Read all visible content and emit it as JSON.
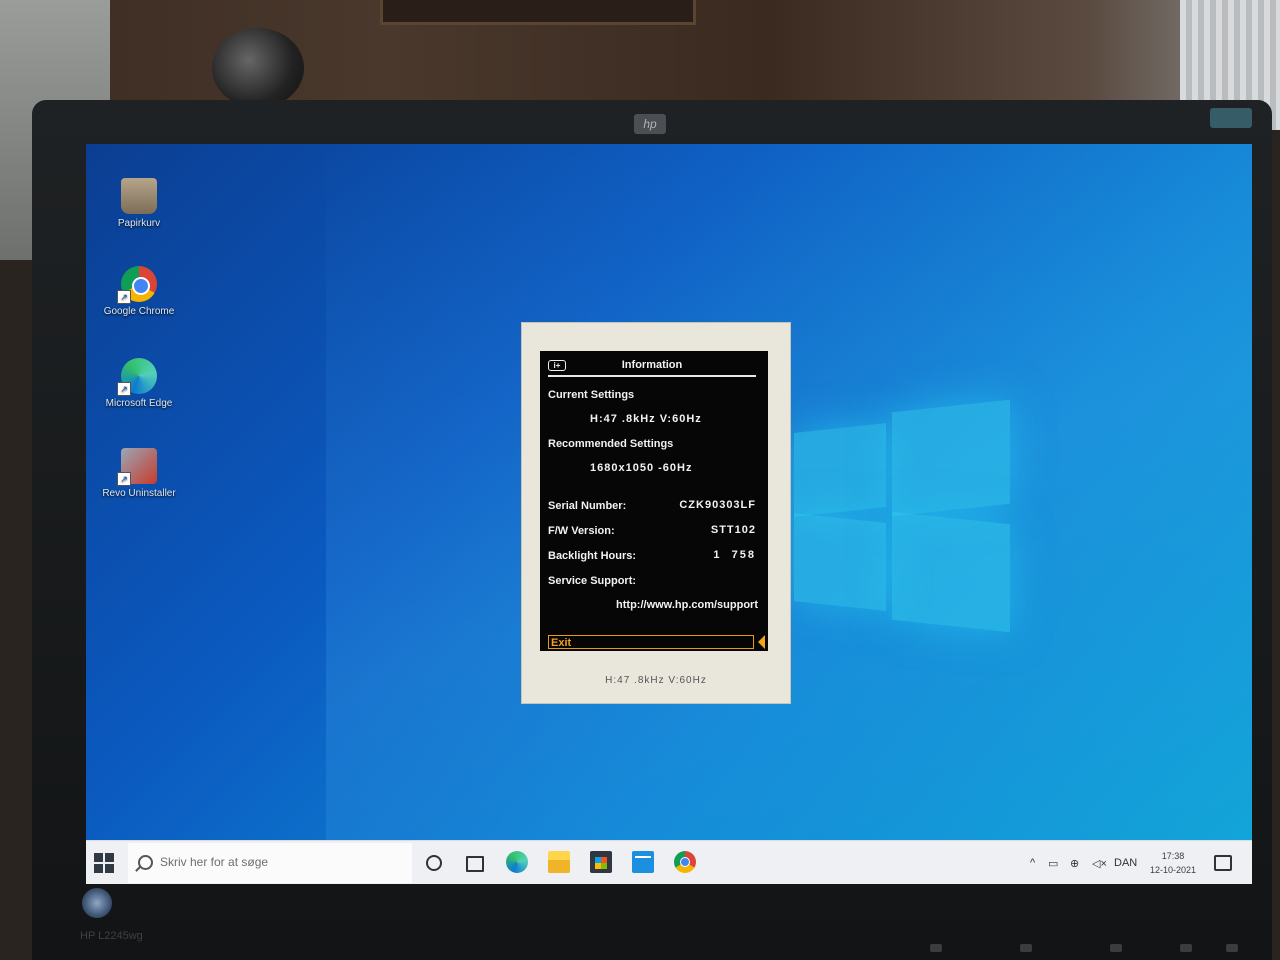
{
  "desktop": {
    "icons": [
      {
        "label": "Papirkurv",
        "icon": "recycle-bin-icon"
      },
      {
        "label": "Google Chrome",
        "icon": "chrome-icon"
      },
      {
        "label": "Microsoft Edge",
        "icon": "edge-icon"
      },
      {
        "label": "Revo Uninstaller",
        "icon": "revo-uninstaller-icon"
      }
    ]
  },
  "monitor": {
    "brand_logo": "hp",
    "model": "HP L2245wg"
  },
  "osd": {
    "title": "Information",
    "current_settings_label": "Current Settings",
    "current_settings_value": "H:47 .8kHz V:60Hz",
    "recommended_settings_label": "Recommended Settings",
    "recommended_settings_value": "1680x1050 -60Hz",
    "serial_number_label": "Serial Number:",
    "serial_number_value": "CZK90303LF",
    "fw_version_label": "F/W Version:",
    "fw_version_value": "STT102",
    "backlight_hours_label": "Backlight Hours:",
    "backlight_hours_value": "1  758",
    "service_support_label": "Service Support:",
    "service_support_value": "http://www.hp.com/support",
    "exit_label": "Exit",
    "footer": "H:47 .8kHz V:60Hz"
  },
  "taskbar": {
    "search_placeholder": "Skriv her for at søge",
    "pinned": [
      "cortana-icon",
      "task-view-icon",
      "edge-icon",
      "file-explorer-icon",
      "store-icon",
      "mail-icon",
      "chrome-icon"
    ],
    "tray": {
      "chevron": "^",
      "language": "DAN",
      "time": "17:38",
      "date": "12-10-2021"
    }
  },
  "colors": {
    "osd_accent": "#f3a21a",
    "osd_background": "#060606",
    "taskbar": "#eef0f3"
  }
}
